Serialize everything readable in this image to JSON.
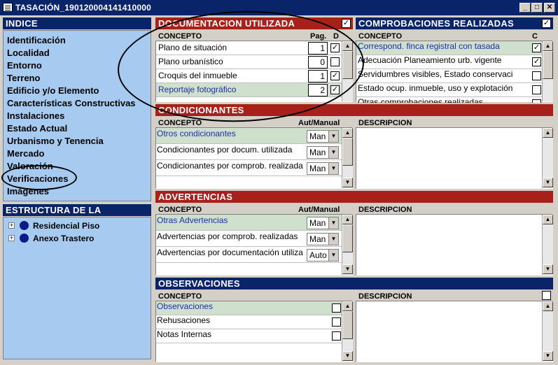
{
  "window": {
    "title": "TASACIÓN_190120004141410000",
    "min_label": "_",
    "max_label": "□",
    "close_label": "✕"
  },
  "indice": {
    "header": "INDICE",
    "items": [
      "Identificación",
      "Localidad",
      "Entorno",
      "Terreno",
      "Edificio y/o Elemento",
      "Características Constructivas",
      "Instalaciones",
      "Estado Actual",
      "Urbanismo y Tenencia",
      "Mercado",
      "Valoración",
      "Verificaciones",
      "Imágenes"
    ]
  },
  "estructura": {
    "header": "ESTRUCTURA DE LA TASACION",
    "items": [
      "Residencial Piso",
      "Anexo Trastero"
    ],
    "expander": "+"
  },
  "documentacion": {
    "header": "DOCUMENTACION UTILIZADA",
    "col_concepto": "CONCEPTO",
    "col_pag": "Pag.",
    "col_d": "D",
    "rows": [
      {
        "label": "Plano de situación",
        "pag": "1",
        "checked": "✓"
      },
      {
        "label": "Plano urbanístico",
        "pag": "0",
        "checked": ""
      },
      {
        "label": "Croquis del inmueble",
        "pag": "1",
        "checked": "✓"
      },
      {
        "label": "Reportaje fotográfico",
        "pag": "2",
        "checked": "✓"
      }
    ],
    "header_check": "✓"
  },
  "comprobaciones": {
    "header": "COMPROBACIONES REALIZADAS",
    "col_concepto": "CONCEPTO",
    "col_c": "C",
    "header_check": "✓",
    "rows": [
      {
        "label": "Correspond. finca registral con tasada",
        "checked": "✓"
      },
      {
        "label": "Adecuación Planeamiento urb. vigente",
        "checked": "✓"
      },
      {
        "label": "Servidumbres visibles, Estado conservaci",
        "checked": ""
      },
      {
        "label": "Estado ocup. inmueble, uso y explotación",
        "checked": ""
      },
      {
        "label": "Otras comprobaciones realizadas",
        "checked": ""
      }
    ]
  },
  "condicionantes": {
    "header": "CONDICIONANTES",
    "col_concepto": "CONCEPTO",
    "col_aut": "Aut/Manual",
    "col_desc": "DESCRIPCION",
    "rows": [
      {
        "label": "Otros condicionantes",
        "mode": "Man"
      },
      {
        "label": "Condicionantes por docum. utilizada",
        "mode": "Man"
      },
      {
        "label": "Condicionantes por comprob. realizada",
        "mode": "Man"
      }
    ]
  },
  "advertencias": {
    "header": "ADVERTENCIAS",
    "col_concepto": "CONCEPTO",
    "col_aut": "Aut/Manual",
    "col_desc": "DESCRIPCION",
    "rows": [
      {
        "label": "Otras Advertencias",
        "mode": "Man"
      },
      {
        "label": "Advertencias por comprob. realizadas",
        "mode": "Man"
      },
      {
        "label": "Advertencias por documentación utiliza",
        "mode": "Auto"
      }
    ]
  },
  "observaciones": {
    "header": "OBSERVACIONES",
    "col_concepto": "CONCEPTO",
    "col_desc": "DESCRIPCION",
    "rows": [
      {
        "label": "Observaciones"
      },
      {
        "label": "Rehusaciones"
      },
      {
        "label": "Notas Internas"
      }
    ]
  },
  "icons": {
    "arrow_up": "▲",
    "arrow_down": "▼",
    "dropdown": "▼"
  }
}
